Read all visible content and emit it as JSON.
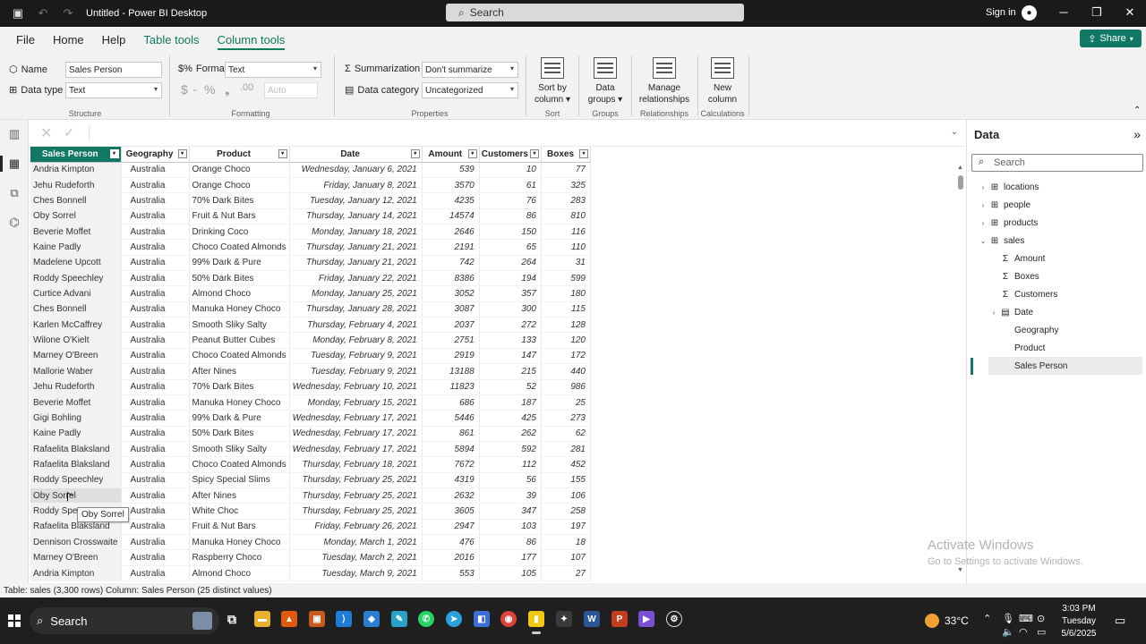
{
  "window": {
    "title": "Untitled - Power BI Desktop",
    "search_label": "Search",
    "signin_label": "Sign in"
  },
  "menu": {
    "tabs": [
      "File",
      "Home",
      "Help",
      "Table tools",
      "Column tools"
    ],
    "share_label": "Share"
  },
  "ribbon": {
    "structure": {
      "name_label": "Name",
      "name_value": "Sales Person",
      "datatype_label": "Data type",
      "datatype_value": "Text",
      "group_label": "Structure"
    },
    "formatting": {
      "format_label": "Format",
      "format_value": "Text",
      "auto_placeholder": "Auto",
      "group_label": "Formatting"
    },
    "properties": {
      "summarization_label": "Summarization",
      "summarization_value": "Don't summarize",
      "category_label": "Data category",
      "category_value": "Uncategorized",
      "group_label": "Properties"
    },
    "sort": {
      "button_label_1": "Sort by",
      "button_label_2": "column",
      "group_label": "Sort"
    },
    "groups": {
      "button_label_1": "Data",
      "button_label_2": "groups",
      "group_label": "Groups"
    },
    "relationships": {
      "button_label_1": "Manage",
      "button_label_2": "relationships",
      "group_label": "Relationships"
    },
    "calculations": {
      "button_label_1": "New",
      "button_label_2": "column",
      "group_label": "Calculations"
    }
  },
  "table": {
    "columns": [
      "Sales Person",
      "Geography",
      "Product",
      "Date",
      "Amount",
      "Customers",
      "Boxes"
    ],
    "rows": [
      [
        "Andria Kimpton",
        "Australia",
        "Orange Choco",
        "Wednesday, January 6, 2021",
        "539",
        "10",
        "77"
      ],
      [
        "Jehu Rudeforth",
        "Australia",
        "Orange Choco",
        "Friday, January 8, 2021",
        "3570",
        "61",
        "325"
      ],
      [
        "Ches Bonnell",
        "Australia",
        "70% Dark Bites",
        "Tuesday, January 12, 2021",
        "4235",
        "76",
        "283"
      ],
      [
        "Oby Sorrel",
        "Australia",
        "Fruit & Nut Bars",
        "Thursday, January 14, 2021",
        "14574",
        "86",
        "810"
      ],
      [
        "Beverie Moffet",
        "Australia",
        "Drinking Coco",
        "Monday, January 18, 2021",
        "2646",
        "150",
        "116"
      ],
      [
        "Kaine Padly",
        "Australia",
        "Choco Coated Almonds",
        "Thursday, January 21, 2021",
        "2191",
        "65",
        "110"
      ],
      [
        "Madelene Upcott",
        "Australia",
        "99% Dark & Pure",
        "Thursday, January 21, 2021",
        "742",
        "264",
        "31"
      ],
      [
        "Roddy Speechley",
        "Australia",
        "50% Dark Bites",
        "Friday, January 22, 2021",
        "8386",
        "194",
        "599"
      ],
      [
        "Curtice Advani",
        "Australia",
        "Almond Choco",
        "Monday, January 25, 2021",
        "3052",
        "357",
        "180"
      ],
      [
        "Ches Bonnell",
        "Australia",
        "Manuka Honey Choco",
        "Thursday, January 28, 2021",
        "3087",
        "300",
        "115"
      ],
      [
        "Karlen McCaffrey",
        "Australia",
        "Smooth Sliky Salty",
        "Thursday, February 4, 2021",
        "2037",
        "272",
        "128"
      ],
      [
        "Wilone O'Kielt",
        "Australia",
        "Peanut Butter Cubes",
        "Monday, February 8, 2021",
        "2751",
        "133",
        "120"
      ],
      [
        "Marney O'Breen",
        "Australia",
        "Choco Coated Almonds",
        "Tuesday, February 9, 2021",
        "2919",
        "147",
        "172"
      ],
      [
        "Mallorie Waber",
        "Australia",
        "After Nines",
        "Tuesday, February 9, 2021",
        "13188",
        "215",
        "440"
      ],
      [
        "Jehu Rudeforth",
        "Australia",
        "70% Dark Bites",
        "Wednesday, February 10, 2021",
        "11823",
        "52",
        "986"
      ],
      [
        "Beverie Moffet",
        "Australia",
        "Manuka Honey Choco",
        "Monday, February 15, 2021",
        "686",
        "187",
        "25"
      ],
      [
        "Gigi Bohling",
        "Australia",
        "99% Dark & Pure",
        "Wednesday, February 17, 2021",
        "5446",
        "425",
        "273"
      ],
      [
        "Kaine Padly",
        "Australia",
        "50% Dark Bites",
        "Wednesday, February 17, 2021",
        "861",
        "262",
        "62"
      ],
      [
        "Rafaelita Blaksland",
        "Australia",
        "Smooth Sliky Salty",
        "Wednesday, February 17, 2021",
        "5894",
        "592",
        "281"
      ],
      [
        "Rafaelita Blaksland",
        "Australia",
        "Choco Coated Almonds",
        "Thursday, February 18, 2021",
        "7672",
        "112",
        "452"
      ],
      [
        "Roddy Speechley",
        "Australia",
        "Spicy Special Slims",
        "Thursday, February 25, 2021",
        "4319",
        "56",
        "155"
      ],
      [
        "Oby Sorrel",
        "Australia",
        "After Nines",
        "Thursday, February 25, 2021",
        "2632",
        "39",
        "106"
      ],
      [
        "Roddy Spe",
        "Australia",
        "White Choc",
        "Thursday, February 25, 2021",
        "3605",
        "347",
        "258"
      ],
      [
        "Rafaelita Blaksland",
        "Australia",
        "Fruit & Nut Bars",
        "Friday, February 26, 2021",
        "2947",
        "103",
        "197"
      ],
      [
        "Dennison Crosswaite",
        "Australia",
        "Manuka Honey Choco",
        "Monday, March 1, 2021",
        "476",
        "86",
        "18"
      ],
      [
        "Marney O'Breen",
        "Australia",
        "Raspberry Choco",
        "Tuesday, March 2, 2021",
        "2016",
        "177",
        "107"
      ],
      [
        "Andria Kimpton",
        "Australia",
        "Almond Choco",
        "Tuesday, March 9, 2021",
        "553",
        "105",
        "27"
      ]
    ],
    "tooltip": "Oby Sorrel"
  },
  "data_pane": {
    "title": "Data",
    "search_placeholder": "Search",
    "items": [
      {
        "label": "locations",
        "icon": "table-icon",
        "expanded": false
      },
      {
        "label": "people",
        "icon": "table-icon",
        "expanded": false
      },
      {
        "label": "products",
        "icon": "table-icon",
        "expanded": false
      },
      {
        "label": "sales",
        "icon": "table-icon",
        "expanded": true
      },
      {
        "label": "Amount",
        "icon": "sigma-icon"
      },
      {
        "label": "Boxes",
        "icon": "sigma-icon"
      },
      {
        "label": "Customers",
        "icon": "sigma-icon"
      },
      {
        "label": "Date",
        "icon": "calendar-icon",
        "expanded": false
      },
      {
        "label": "Geography",
        "icon": ""
      },
      {
        "label": "Product",
        "icon": ""
      },
      {
        "label": "Sales Person",
        "icon": "",
        "selected": true
      }
    ]
  },
  "status": {
    "text": "Table: sales (3,300 rows) Column: Sales Person (25 distinct values)"
  },
  "watermark": {
    "line1": "Activate Windows",
    "line2": "Go to Settings to activate Windows."
  },
  "taskbar": {
    "search_label": "Search",
    "temperature": "33°C",
    "time": "3:03 PM",
    "day": "Tuesday",
    "date": "5/6/2025"
  },
  "colors": {
    "accent": "#117865",
    "titlebar": "#1a1a1a",
    "taskbar": "#1f1f1f"
  }
}
